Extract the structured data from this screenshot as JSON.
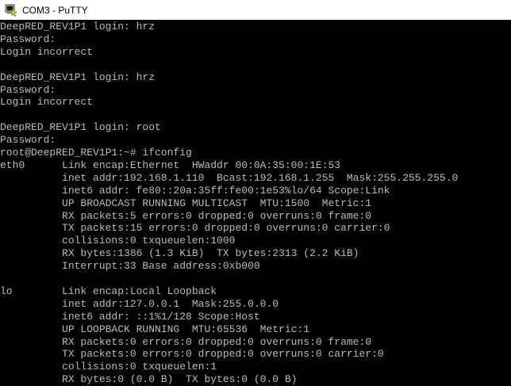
{
  "window": {
    "title": "COM3 - PuTTY",
    "icon": "putty-terminal-icon"
  },
  "colors": {
    "terminal_background": "#000000",
    "terminal_foreground": "#bbbbbb",
    "titlebar_background": "#ffffff"
  },
  "terminal": {
    "lines": [
      "DeepRED_REV1P1 login: hrz",
      "Password:",
      "Login incorrect",
      "",
      "DeepRED_REV1P1 login: hrz",
      "Password:",
      "Login incorrect",
      "",
      "DeepRED_REV1P1 login: root",
      "Password:",
      "root@DeepRED_REV1P1:~# ifconfig",
      "eth0      Link encap:Ethernet  HWaddr 00:0A:35:00:1E:53",
      "          inet addr:192.168.1.110  Bcast:192.168.1.255  Mask:255.255.255.0",
      "          inet6 addr: fe80::20a:35ff:fe00:1e53%lo/64 Scope:Link",
      "          UP BROADCAST RUNNING MULTICAST  MTU:1500  Metric:1",
      "          RX packets:5 errors:0 dropped:0 overruns:0 frame:0",
      "          TX packets:15 errors:0 dropped:0 overruns:0 carrier:0",
      "          collisions:0 txqueuelen:1000",
      "          RX bytes:1386 (1.3 KiB)  TX bytes:2313 (2.2 KiB)",
      "          Interrupt:33 Base address:0xb000",
      "",
      "lo        Link encap:Local Loopback",
      "          inet addr:127.0.0.1  Mask:255.0.0.0",
      "          inet6 addr: ::1%1/128 Scope:Host",
      "          UP LOOPBACK RUNNING  MTU:65536  Metric:1",
      "          RX packets:0 errors:0 dropped:0 overruns:0 frame:0",
      "          TX packets:0 errors:0 dropped:0 overruns:0 carrier:0",
      "          collisions:0 txqueuelen:1",
      "          RX bytes:0 (0.0 B)  TX bytes:0 (0.0 B)"
    ]
  }
}
